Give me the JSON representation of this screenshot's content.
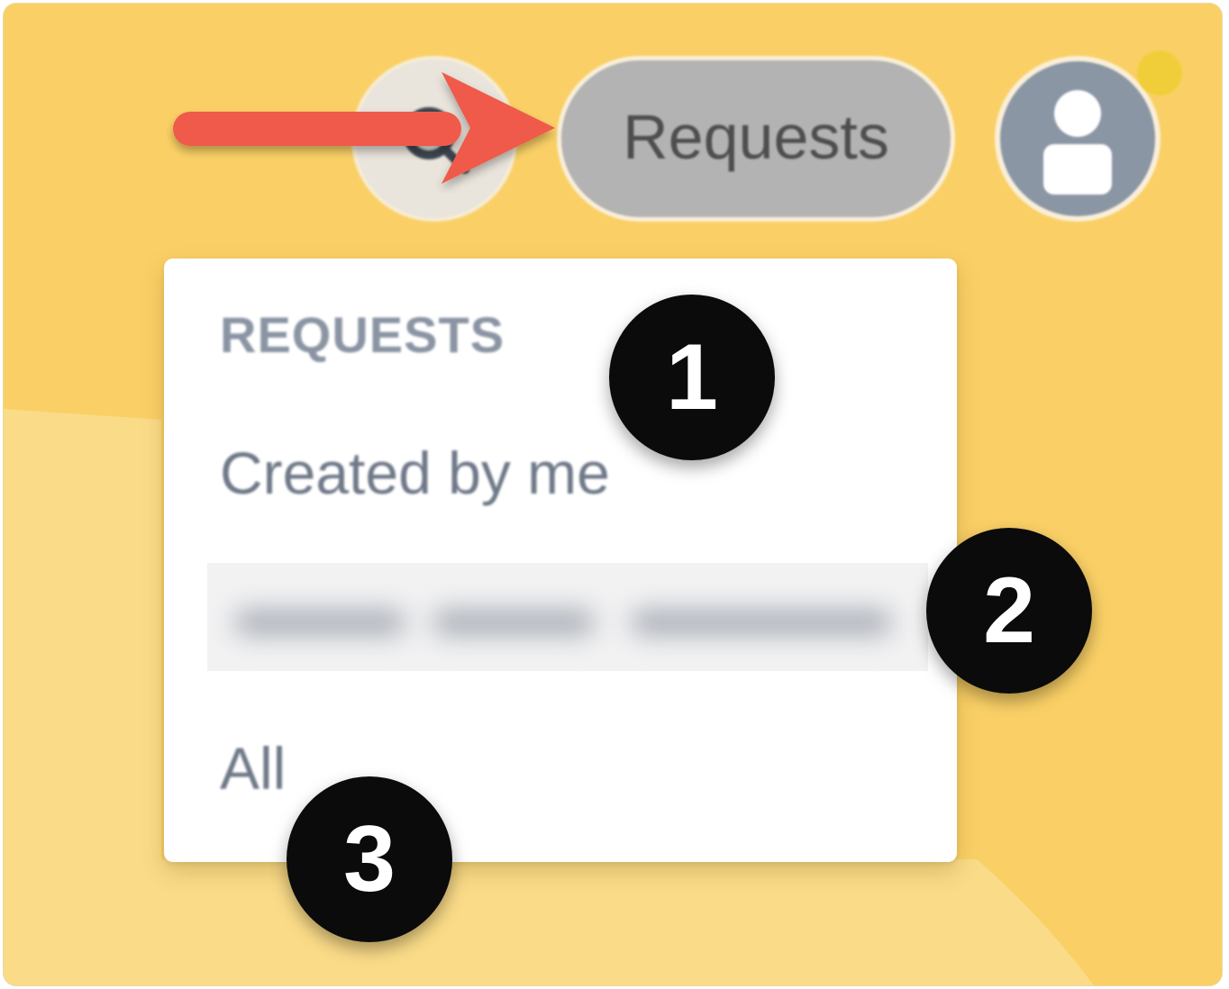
{
  "toolbar": {
    "requests_label": "Requests",
    "search_icon": "search-icon",
    "avatar_icon": "user-avatar-icon"
  },
  "menu": {
    "header": "REQUESTS",
    "items": [
      {
        "label": "Created by me"
      },
      {
        "label": "",
        "redacted": true
      },
      {
        "label": "All"
      }
    ]
  },
  "callouts": [
    "1",
    "2",
    "3"
  ],
  "colors": {
    "background": "#fad066",
    "background_light": "#fadb88",
    "arrow": "#ef5a4c",
    "requests_button": "#b3b3b3",
    "avatar": "#8b96a5",
    "notification_dot": "#f0ce3a",
    "callout": "#0b0b0b"
  }
}
